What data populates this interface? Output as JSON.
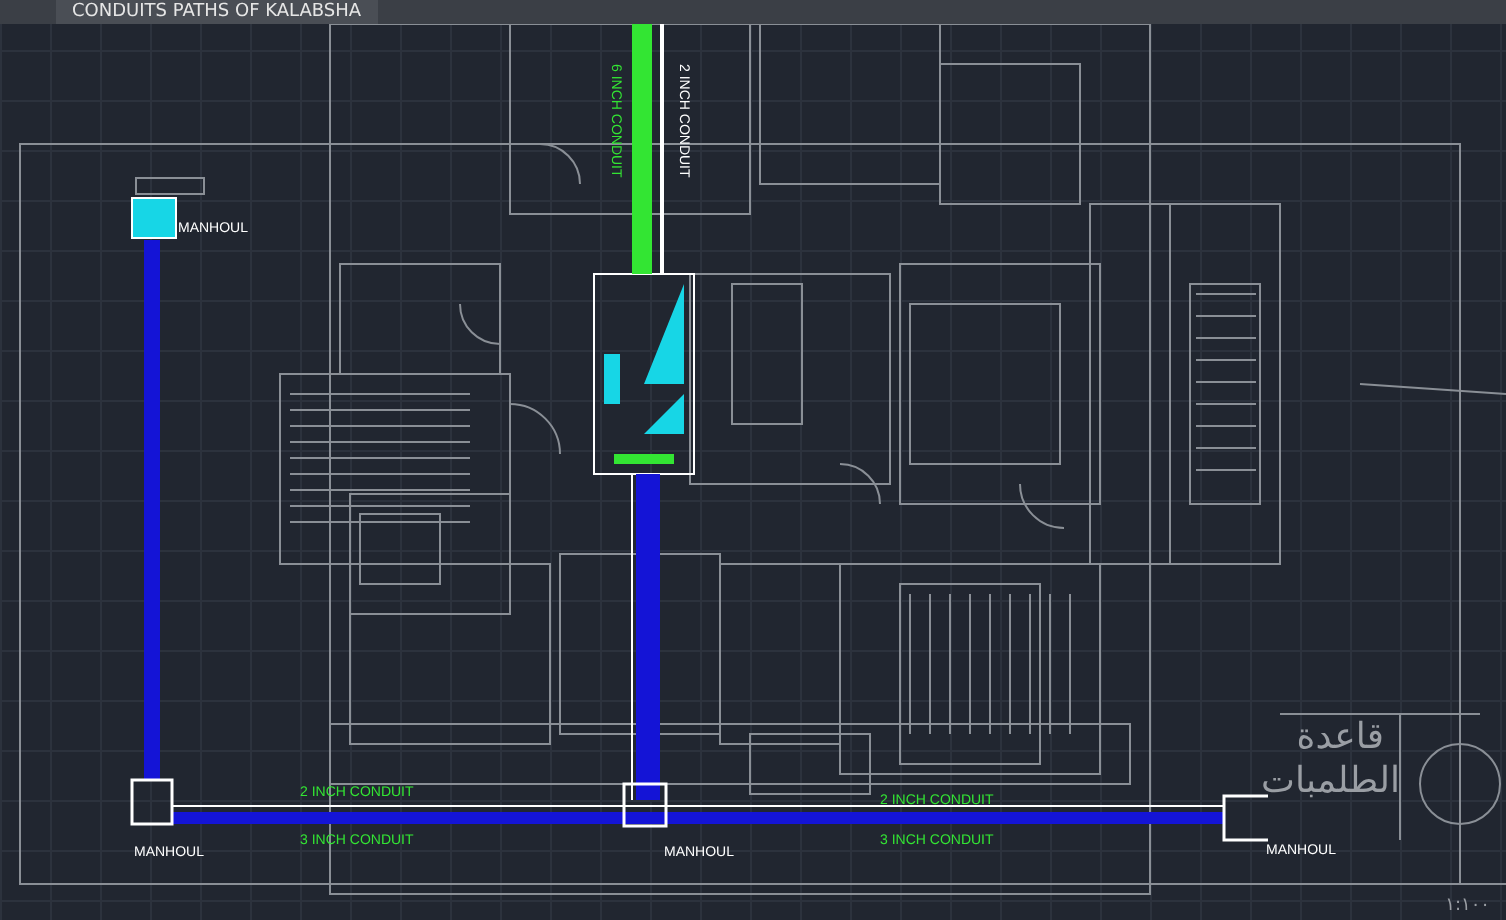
{
  "tab": {
    "title": "CONDUITS PATHS OF KALABSHA"
  },
  "vertical_labels": [
    {
      "text": "6 INCH CONDUIT",
      "color": "#33e533"
    },
    {
      "text": "2 INCH CONDUIT",
      "color": "#ffffff"
    }
  ],
  "manholes": [
    {
      "label": "MANHOUL"
    },
    {
      "label": "MANHOUL"
    },
    {
      "label": "MANHOUL"
    },
    {
      "label": "MANHOUL"
    }
  ],
  "conduit_labels": [
    {
      "text": "2 INCH CONDUIT"
    },
    {
      "text": "3 INCH CONDUIT"
    },
    {
      "text": "2 INCH CONDUIT"
    },
    {
      "text": "3 INCH CONDUIT"
    }
  ],
  "pump_base": {
    "lines": [
      "قاعدة",
      "الطلمبات"
    ]
  },
  "scale": "١:١٠٠"
}
